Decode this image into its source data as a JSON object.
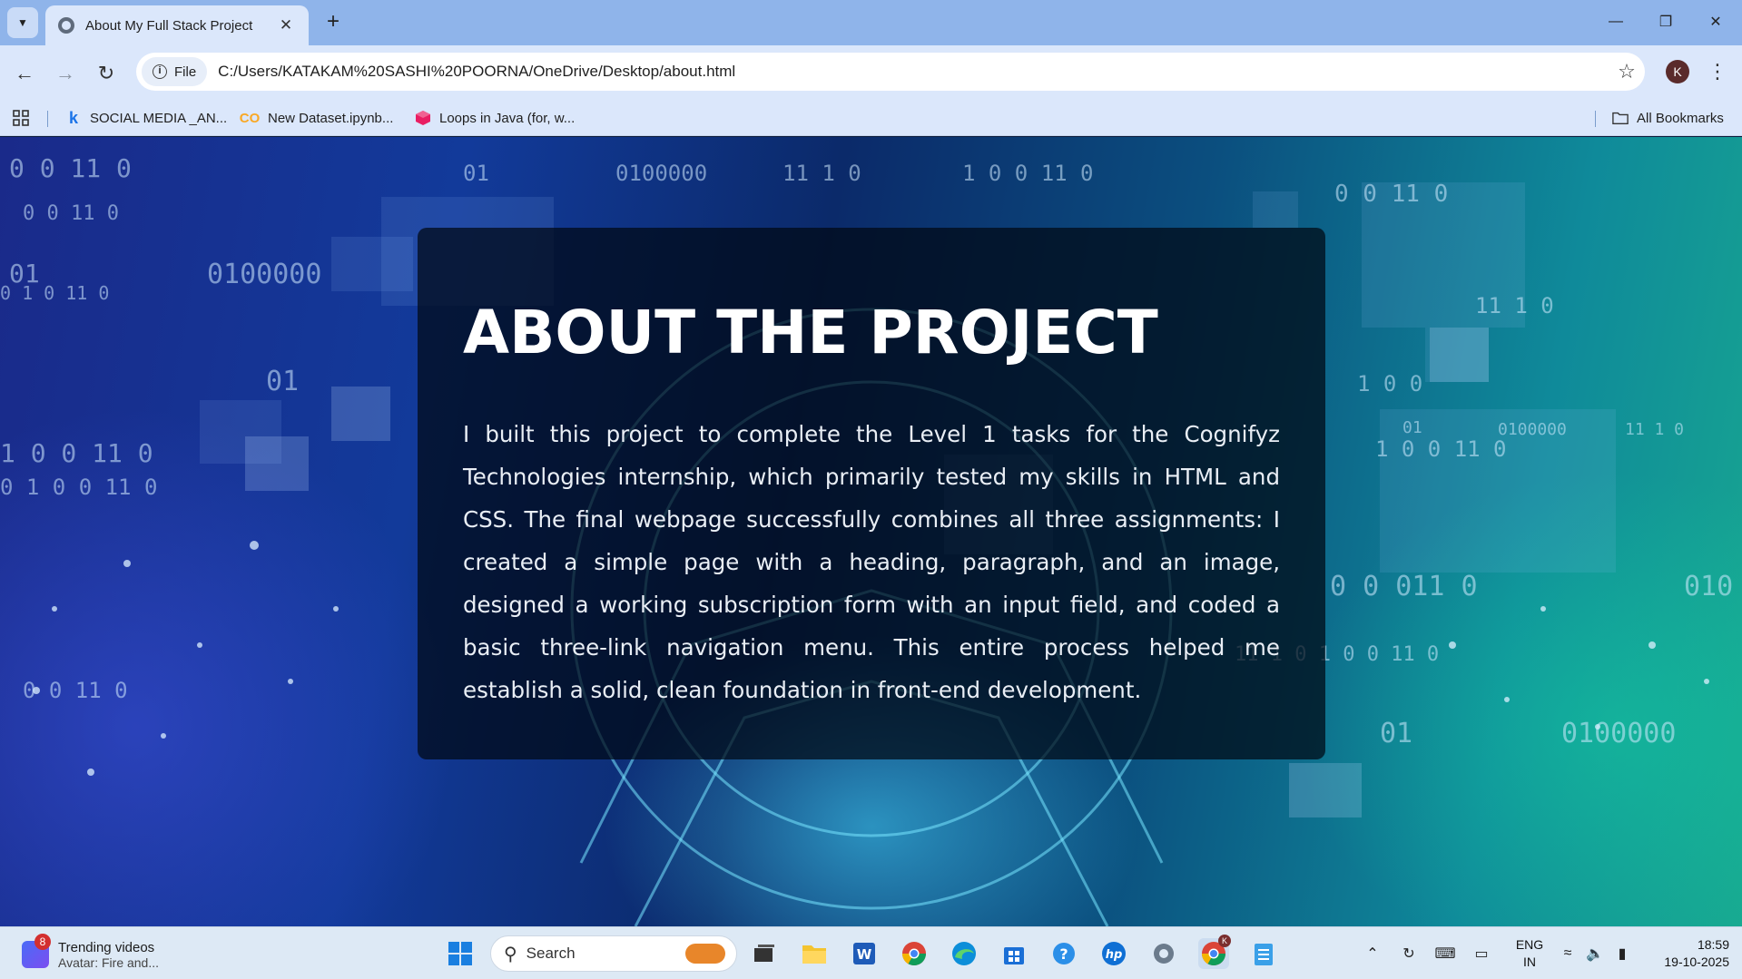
{
  "browser": {
    "tab_title": "About My Full Stack Project",
    "address_chip": "File",
    "url": "C:/Users/KATAKAM%20SASHI%20POORNA/OneDrive/Desktop/about.html",
    "profile_initial": "K",
    "bookmarks": [
      {
        "label": "SOCIAL MEDIA _AN...",
        "icon": "k-logo-icon"
      },
      {
        "label": "New Dataset.ipynb...",
        "icon": "colab-icon"
      },
      {
        "label": "Loops in Java (for, w...",
        "icon": "cube-icon"
      }
    ],
    "all_bookmarks_label": "All Bookmarks"
  },
  "page": {
    "heading": "ABOUT THE PROJECT",
    "paragraph": "I built this project to complete the Level 1 tasks for the Cognifyz Technologies internship, which primarily tested my skills in HTML and CSS. The final webpage successfully combines all three assignments: I created a simple page with a heading, paragraph, and an image, designed a working subscription form with an input field, and coded a basic three-link navigation menu. This entire process helped me establish a solid, clean foundation in front-end development.",
    "background_numbers": [
      "0 0 11 0",
      "0 0 11 0",
      "01",
      "0100000",
      "1 0 0 11 0",
      "01",
      "0 1 0 0 11 0",
      "0 1 0 11 0",
      "0 0 11 0",
      "01",
      "0100000",
      "11 1 0",
      "1 0 0 11 0",
      "0 0 11 0",
      "11 1 0",
      "1 0 0",
      "01",
      "0100000",
      "11 1 0",
      "1 0 0 11 0",
      "0 0 011 0",
      "010",
      "11 1 0 1 0 0 11 0",
      "01",
      "0100000"
    ]
  },
  "taskbar": {
    "widget_badge": "8",
    "widget_title": "Trending videos",
    "widget_subtitle": "Avatar: Fire and...",
    "search_placeholder": "Search",
    "language_line1": "ENG",
    "language_line2": "IN",
    "time": "18:59",
    "date": "19-10-2025",
    "chrome_badge": "K"
  },
  "colors": {
    "tabbar": "#8fb4ea",
    "toolbar": "#dbe7fb",
    "card_overlay": "rgba(0,8,20,0.72)",
    "taskbar": "#dde9f5"
  }
}
